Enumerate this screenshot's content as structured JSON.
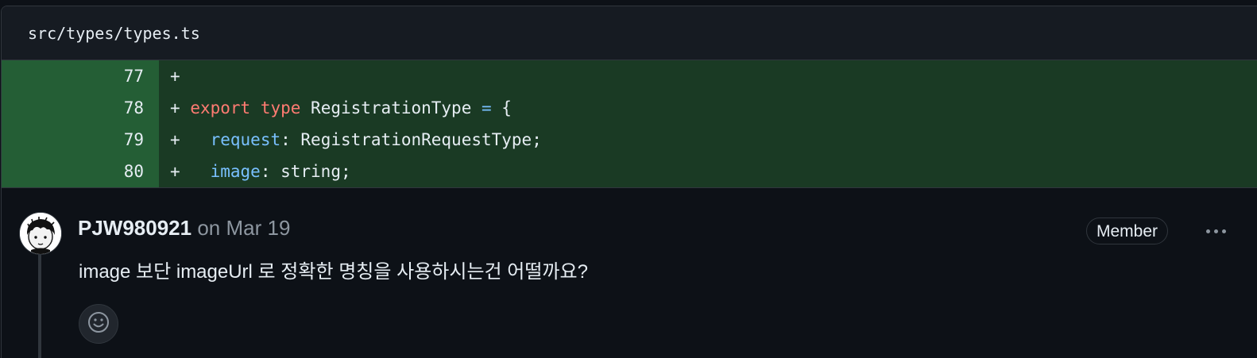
{
  "file": {
    "path": "src/types/types.ts"
  },
  "diff": {
    "lines": [
      {
        "number": "77",
        "marker": "+",
        "tokens": []
      },
      {
        "number": "78",
        "marker": "+",
        "tokens": [
          {
            "type": "kw",
            "text": "export"
          },
          {
            "type": "plain",
            "text": " "
          },
          {
            "type": "kw",
            "text": "type"
          },
          {
            "type": "plain",
            "text": " RegistrationType "
          },
          {
            "type": "op",
            "text": "="
          },
          {
            "type": "plain",
            "text": " {"
          }
        ]
      },
      {
        "number": "79",
        "marker": "+",
        "tokens": [
          {
            "type": "plain",
            "text": "  "
          },
          {
            "type": "prop",
            "text": "request"
          },
          {
            "type": "plain",
            "text": ": RegistrationRequestType;"
          }
        ]
      },
      {
        "number": "80",
        "marker": "+",
        "tokens": [
          {
            "type": "plain",
            "text": "  "
          },
          {
            "type": "prop",
            "text": "image"
          },
          {
            "type": "plain",
            "text": ": string;"
          }
        ]
      }
    ]
  },
  "comment": {
    "author": "PJW980921",
    "date": "on Mar 19",
    "role_badge": "Member",
    "body": "image 보단 imageUrl 로 정확한 명칭을 사용하시는건 어떨까요?",
    "avatar_icon": "user-avatar-icon",
    "more_icon": "kebab-horizontal-icon",
    "reaction_icon": "smiley-icon"
  },
  "colors": {
    "background": "#0d1117",
    "added_line_bg": "#1a3a24",
    "added_number_bg": "#245e35",
    "keyword": "#ff7b72",
    "identifier": "#79c0ff",
    "muted_text": "#8d96a0",
    "border": "#30363d"
  }
}
